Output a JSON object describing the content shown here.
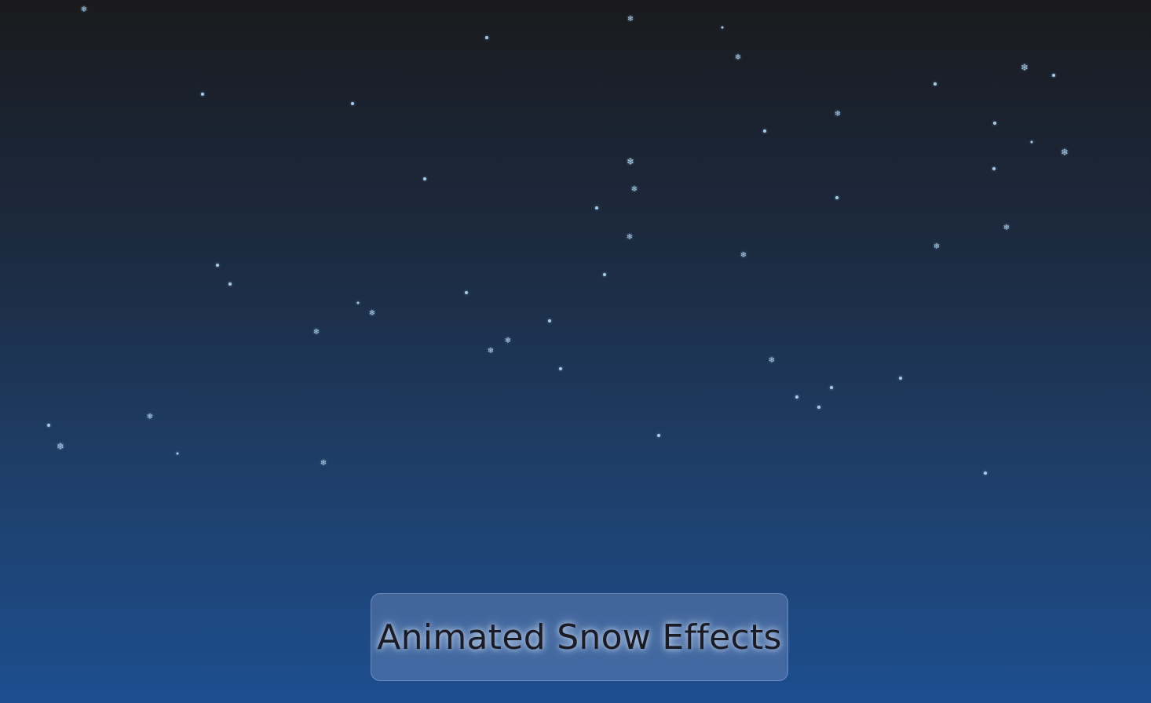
{
  "title": "Animated Snow Effects",
  "icons": {
    "snowflake": "snowflake-icon",
    "snowflake_glyph": "❄"
  },
  "colors": {
    "sky_top": "#1a1a1c",
    "sky_bottom": "#1d4e8f",
    "snow": "#a8cbe8",
    "title_text": "#1b1b26"
  }
}
